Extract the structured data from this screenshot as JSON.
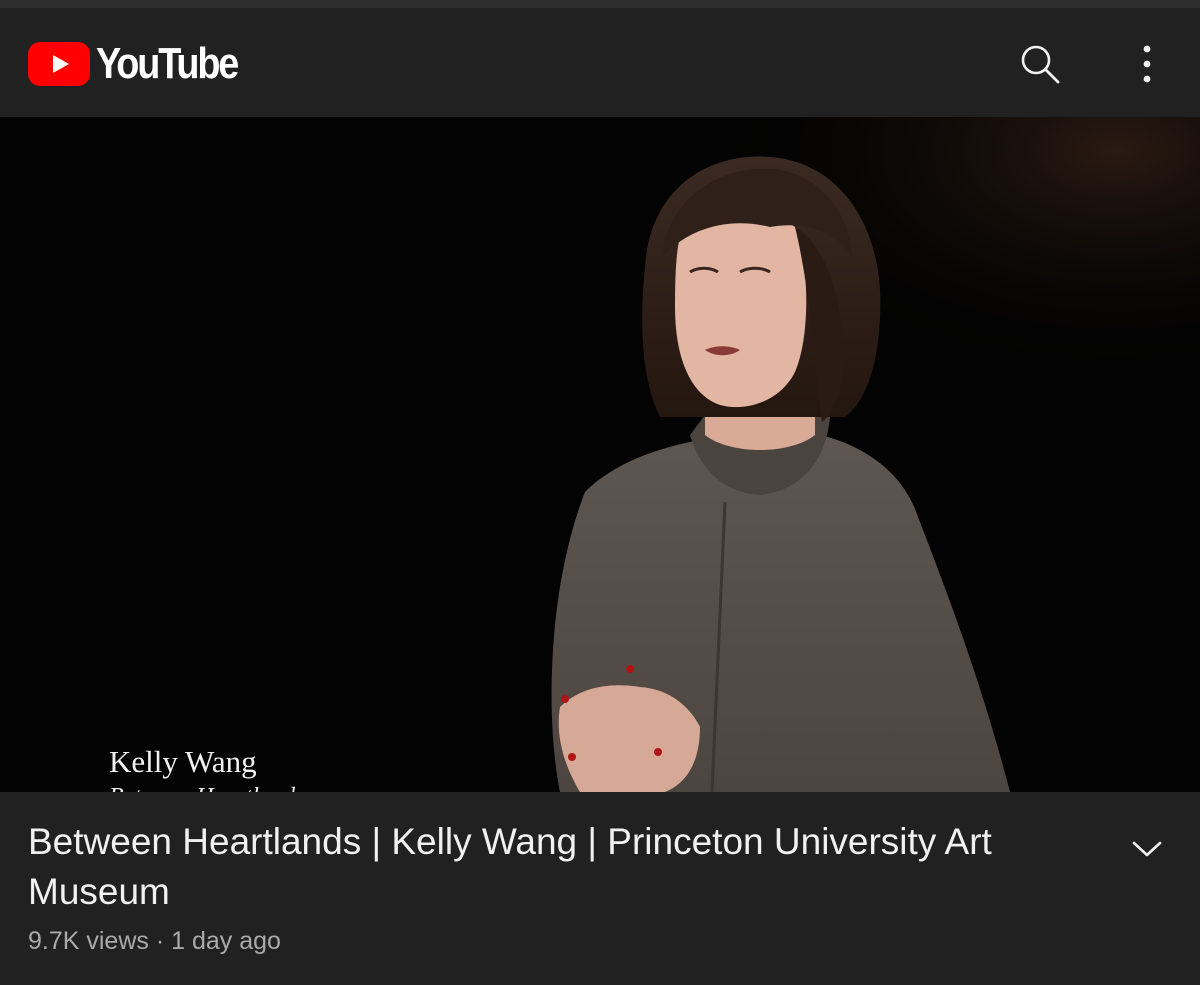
{
  "header": {
    "brand_text": "YouTube",
    "icons": {
      "logo": "youtube-play-logo",
      "search": "search-icon",
      "more": "more-vertical-icon"
    }
  },
  "video": {
    "overlay_name": "Kelly Wang",
    "overlay_subtitle": "Between Heartlands"
  },
  "details": {
    "title": "Between Heartlands | Kelly Wang | Princeton University Art Museum",
    "views": "9.7K views",
    "separator": "·",
    "age": "1 day ago",
    "expand_icon": "chevron-down-icon"
  },
  "colors": {
    "background": "#212121",
    "brand_red": "#ff0000",
    "title_text": "#f1f1f1",
    "meta_text": "#aaaaaa"
  }
}
